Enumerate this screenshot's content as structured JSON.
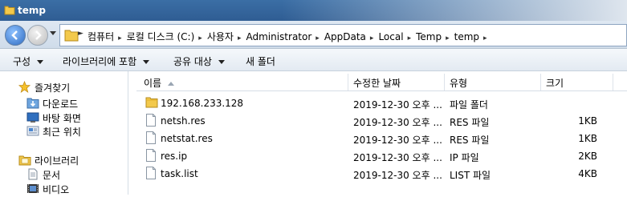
{
  "window": {
    "title": "temp"
  },
  "address": {
    "crumbs": [
      "컴퓨터",
      "로컬 디스크 (C:)",
      "사용자",
      "Administrator",
      "AppData",
      "Local",
      "Temp",
      "temp"
    ]
  },
  "toolbar": {
    "organize": "구성",
    "include_library": "라이브러리에 포함",
    "share_with": "공유 대상",
    "new_folder": "새 폴더"
  },
  "nav": {
    "favorites": "즐겨찾기",
    "downloads": "다운로드",
    "desktop": "바탕 화면",
    "recent": "최근 위치",
    "libraries": "라이브러리",
    "documents": "문서",
    "videos": "비디오"
  },
  "columns": {
    "name": "이름",
    "date": "수정한 날짜",
    "type": "유형",
    "size": "크기"
  },
  "files": [
    {
      "name": "192.168.233.128",
      "date": "2019-12-30 오후 ...",
      "type": "파일 폴더",
      "size": "",
      "kind": "folder"
    },
    {
      "name": "netsh.res",
      "date": "2019-12-30 오후 ...",
      "type": "RES 파일",
      "size": "1KB",
      "kind": "file"
    },
    {
      "name": "netstat.res",
      "date": "2019-12-30 오후 ...",
      "type": "RES 파일",
      "size": "1KB",
      "kind": "file"
    },
    {
      "name": "res.ip",
      "date": "2019-12-30 오후 ...",
      "type": "IP 파일",
      "size": "2KB",
      "kind": "file"
    },
    {
      "name": "task.list",
      "date": "2019-12-30 오후 ...",
      "type": "LIST 파일",
      "size": "4KB",
      "kind": "file"
    }
  ]
}
